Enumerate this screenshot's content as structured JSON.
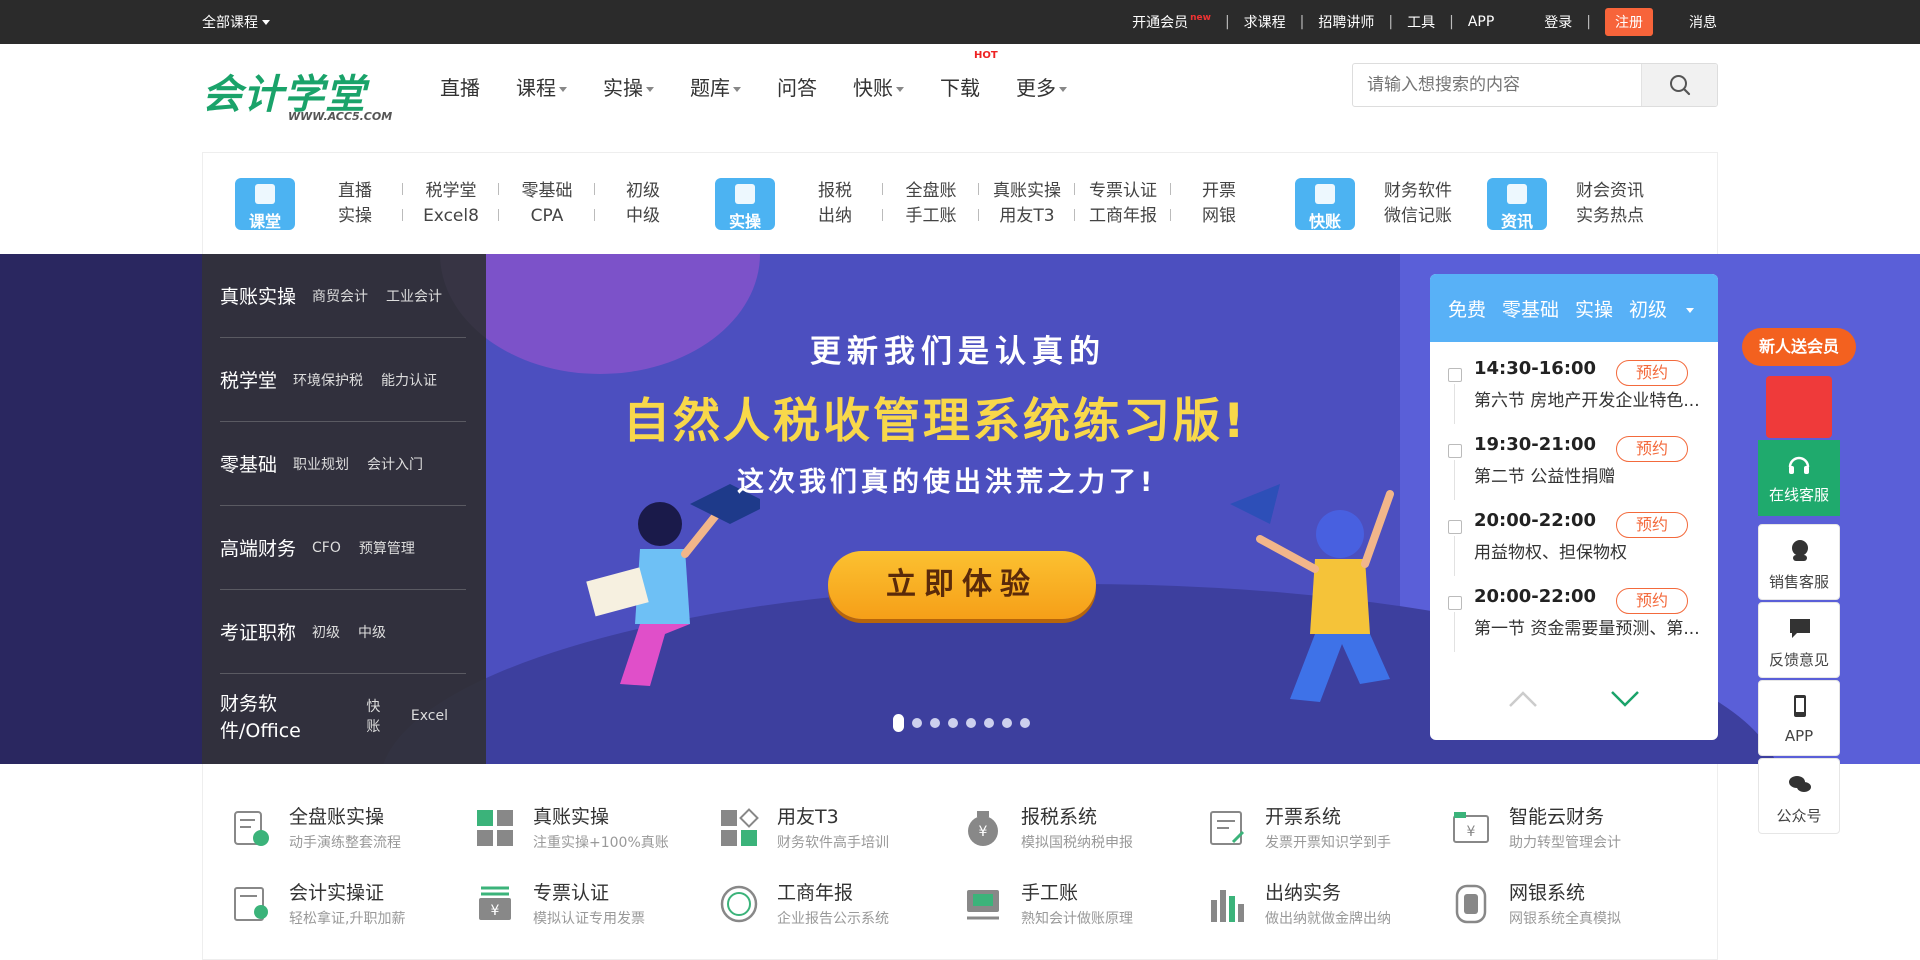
{
  "topbar": {
    "all_courses": "全部课程",
    "links": [
      "开通会员",
      "求课程",
      "招聘讲师",
      "工具",
      "APP",
      "登录"
    ],
    "new_badge": "new",
    "register": "注册",
    "messages": "消息"
  },
  "header": {
    "logo_cn": "会计学堂",
    "logo_en": "WWW.ACC5.COM",
    "nav": [
      {
        "label": "直播",
        "dropdown": false
      },
      {
        "label": "课程",
        "dropdown": true
      },
      {
        "label": "实操",
        "dropdown": true
      },
      {
        "label": "题库",
        "dropdown": true
      },
      {
        "label": "问答",
        "dropdown": false
      },
      {
        "label": "快账",
        "dropdown": true
      },
      {
        "label": "下载",
        "dropdown": false
      },
      {
        "label": "更多",
        "dropdown": true
      }
    ],
    "hot_badge": "HOT",
    "search_placeholder": "请输入想搜索的内容"
  },
  "categories": {
    "groups": [
      {
        "icon_label": "课堂",
        "color": "#4db3f3",
        "cols": [
          [
            "直播",
            "实操"
          ],
          [
            "税学堂",
            "Excel8"
          ],
          [
            "零基础",
            "CPA"
          ],
          [
            "初级",
            "中级"
          ]
        ]
      },
      {
        "icon_label": "实操",
        "color": "#4db3f3",
        "cols": [
          [
            "报税",
            "出纳"
          ],
          [
            "全盘账",
            "手工账"
          ],
          [
            "真账实操",
            "用友T3"
          ],
          [
            "专票认证",
            "工商年报"
          ],
          [
            "开票",
            "网银"
          ]
        ]
      },
      {
        "icon_label": "快账",
        "color": "#4db3f3",
        "cols": [
          [
            "财务软件",
            "微信记账"
          ]
        ]
      },
      {
        "icon_label": "资讯",
        "color": "#4db3f3",
        "cols": [
          [
            "财会资讯",
            "实务热点"
          ]
        ]
      }
    ]
  },
  "side_menu": [
    {
      "title": "真账实操",
      "subs": [
        "商贸会计",
        "工业会计"
      ]
    },
    {
      "title": "税学堂",
      "subs": [
        "环境保护税",
        "能力认证"
      ]
    },
    {
      "title": "零基础",
      "subs": [
        "职业规划",
        "会计入门"
      ]
    },
    {
      "title": "高端财务",
      "subs": [
        "CFO",
        "预算管理"
      ]
    },
    {
      "title": "考证职称",
      "subs": [
        "初级",
        "中级"
      ]
    },
    {
      "title": "财务软件/Office",
      "subs": [
        "快账",
        "Excel"
      ]
    }
  ],
  "hero": {
    "line1": "更新我们是认真的",
    "line2": "自然人税收管理系统练习版!",
    "line3": "这次我们真的使出洪荒之力了!",
    "cta": "立即体验",
    "slide_count": 8,
    "active_slide": 1
  },
  "schedule": {
    "tabs": [
      "免费",
      "零基础",
      "实操",
      "初级"
    ],
    "items": [
      {
        "time": "14:30-16:00",
        "desc": "第六节 房地产开发企业特色...",
        "action": "预约"
      },
      {
        "time": "19:30-21:00",
        "desc": "第二节 公益性捐赠",
        "action": "预约"
      },
      {
        "time": "20:00-22:00",
        "desc": "用益物权、担保物权",
        "action": "预约"
      },
      {
        "time": "20:00-22:00",
        "desc": "第一节 资金需要量预测、第...",
        "action": "预约"
      }
    ]
  },
  "float": {
    "gift": "新人送会员",
    "online": "在线客服",
    "buttons": [
      "销售客服",
      "反馈意见",
      "APP",
      "公众号"
    ]
  },
  "features": [
    {
      "title": "全盘账实操",
      "sub": "动手演练整套流程",
      "icon": "ledger-icon"
    },
    {
      "title": "真账实操",
      "sub": "注重实操+100%真账",
      "icon": "calculator-icon"
    },
    {
      "title": "用友T3",
      "sub": "财务软件高手培训",
      "icon": "blocks-icon"
    },
    {
      "title": "报税系统",
      "sub": "模拟国税纳税申报",
      "icon": "money-bag-icon"
    },
    {
      "title": "开票系统",
      "sub": "发票开票知识学到手",
      "icon": "invoice-icon"
    },
    {
      "title": "智能云财务",
      "sub": "助力转型管理会计",
      "icon": "cloud-finance-icon"
    },
    {
      "title": "会计实操证",
      "sub": "轻松拿证,升职加薪",
      "icon": "certificate-icon"
    },
    {
      "title": "专票认证",
      "sub": "模拟认证专用发票",
      "icon": "special-invoice-icon"
    },
    {
      "title": "工商年报",
      "sub": "企业报告公示系统",
      "icon": "report-icon"
    },
    {
      "title": "手工账",
      "sub": "熟知会计做账原理",
      "icon": "manual-ledger-icon"
    },
    {
      "title": "出纳实务",
      "sub": "做出纳就做金牌出纳",
      "icon": "cashier-icon"
    },
    {
      "title": "网银系统",
      "sub": "网银系统全真模拟",
      "icon": "bank-icon"
    }
  ]
}
